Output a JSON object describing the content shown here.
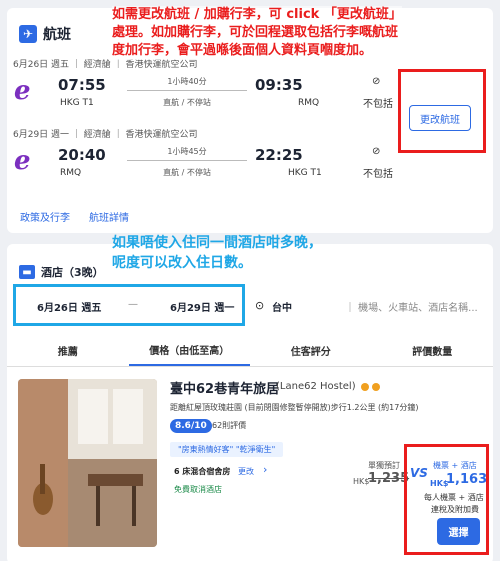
{
  "flight_section": {
    "title": "航班",
    "legs": [
      {
        "date_line": "6月26日 週五 ｜ 經濟艙 ｜ 香港快運航空公司",
        "depart_time": "07:55",
        "depart_airport": "HKG T1",
        "duration": "1小時40分",
        "stops": "直航 / 不停站",
        "arrive_time": "09:35",
        "arrive_airport": "RMQ",
        "baggage": "不包括"
      },
      {
        "date_line": "6月29日 週一 ｜ 經濟艙 ｜ 香港快運航空公司",
        "depart_time": "20:40",
        "depart_airport": "RMQ",
        "duration": "1小時45分",
        "stops": "直航 / 不停站",
        "arrive_time": "22:25",
        "arrive_airport": "HKG T1",
        "baggage": "不包括"
      }
    ],
    "change_button": "更改航班",
    "links": [
      "政策及行李",
      "航班詳情"
    ]
  },
  "annotations": {
    "red_top": [
      "如需更改航班 / 加購行李，可 click 「更改航班」",
      "處理。如加購行李，可於回程選取包括行李嘅航班",
      "度加行李，會平過喺後面個人資料頁嗰度加。"
    ],
    "blue_mid": [
      "如果唔使入住同一間酒店咁多晚，",
      "呢度可以改入住日數。"
    ]
  },
  "hotel_section": {
    "title": "酒店（3晚）",
    "checkin": "6月26日 週五",
    "date_separator": "—",
    "checkout": "6月29日 週一",
    "city": "台中",
    "location_placeholder": "｜ 機場、火車站、酒店名稱...",
    "sort_tabs": [
      "推薦",
      "價格（由低至高）",
      "住客評分",
      "評價數量"
    ],
    "hotel": {
      "name": "臺中62巷青年旅居",
      "name_en": "(Lane62 Hostel)",
      "address": "距離紅屋頂玫瑰莊園 (目前閉園修整暫停開放)步行1.2公里 (約17分鐘)",
      "score": "8.6/10",
      "reviews": "62則評價",
      "tagline": "\"房東熱情好客\" \"乾淨衛生\"",
      "room": "6 床混合宿舍房",
      "room_change": "更改",
      "free_cancel": "免費取消酒店",
      "separate_label": "單獨預訂",
      "separate_currency": "HK$",
      "separate_price": "1,235",
      "vs": "VS",
      "bundle_label": "機票 + 酒店",
      "bundle_currency": "HK$",
      "bundle_price": "1,163",
      "bundle_note1": "每人機票 + 酒店",
      "bundle_note2": "連稅及附加費",
      "select_button": "選擇"
    }
  },
  "colors": {
    "accent": "#2d6ae3",
    "annotation_red": "#ea1d1d",
    "annotation_blue": "#1fa7e6",
    "airline": "#7b2fbf"
  }
}
